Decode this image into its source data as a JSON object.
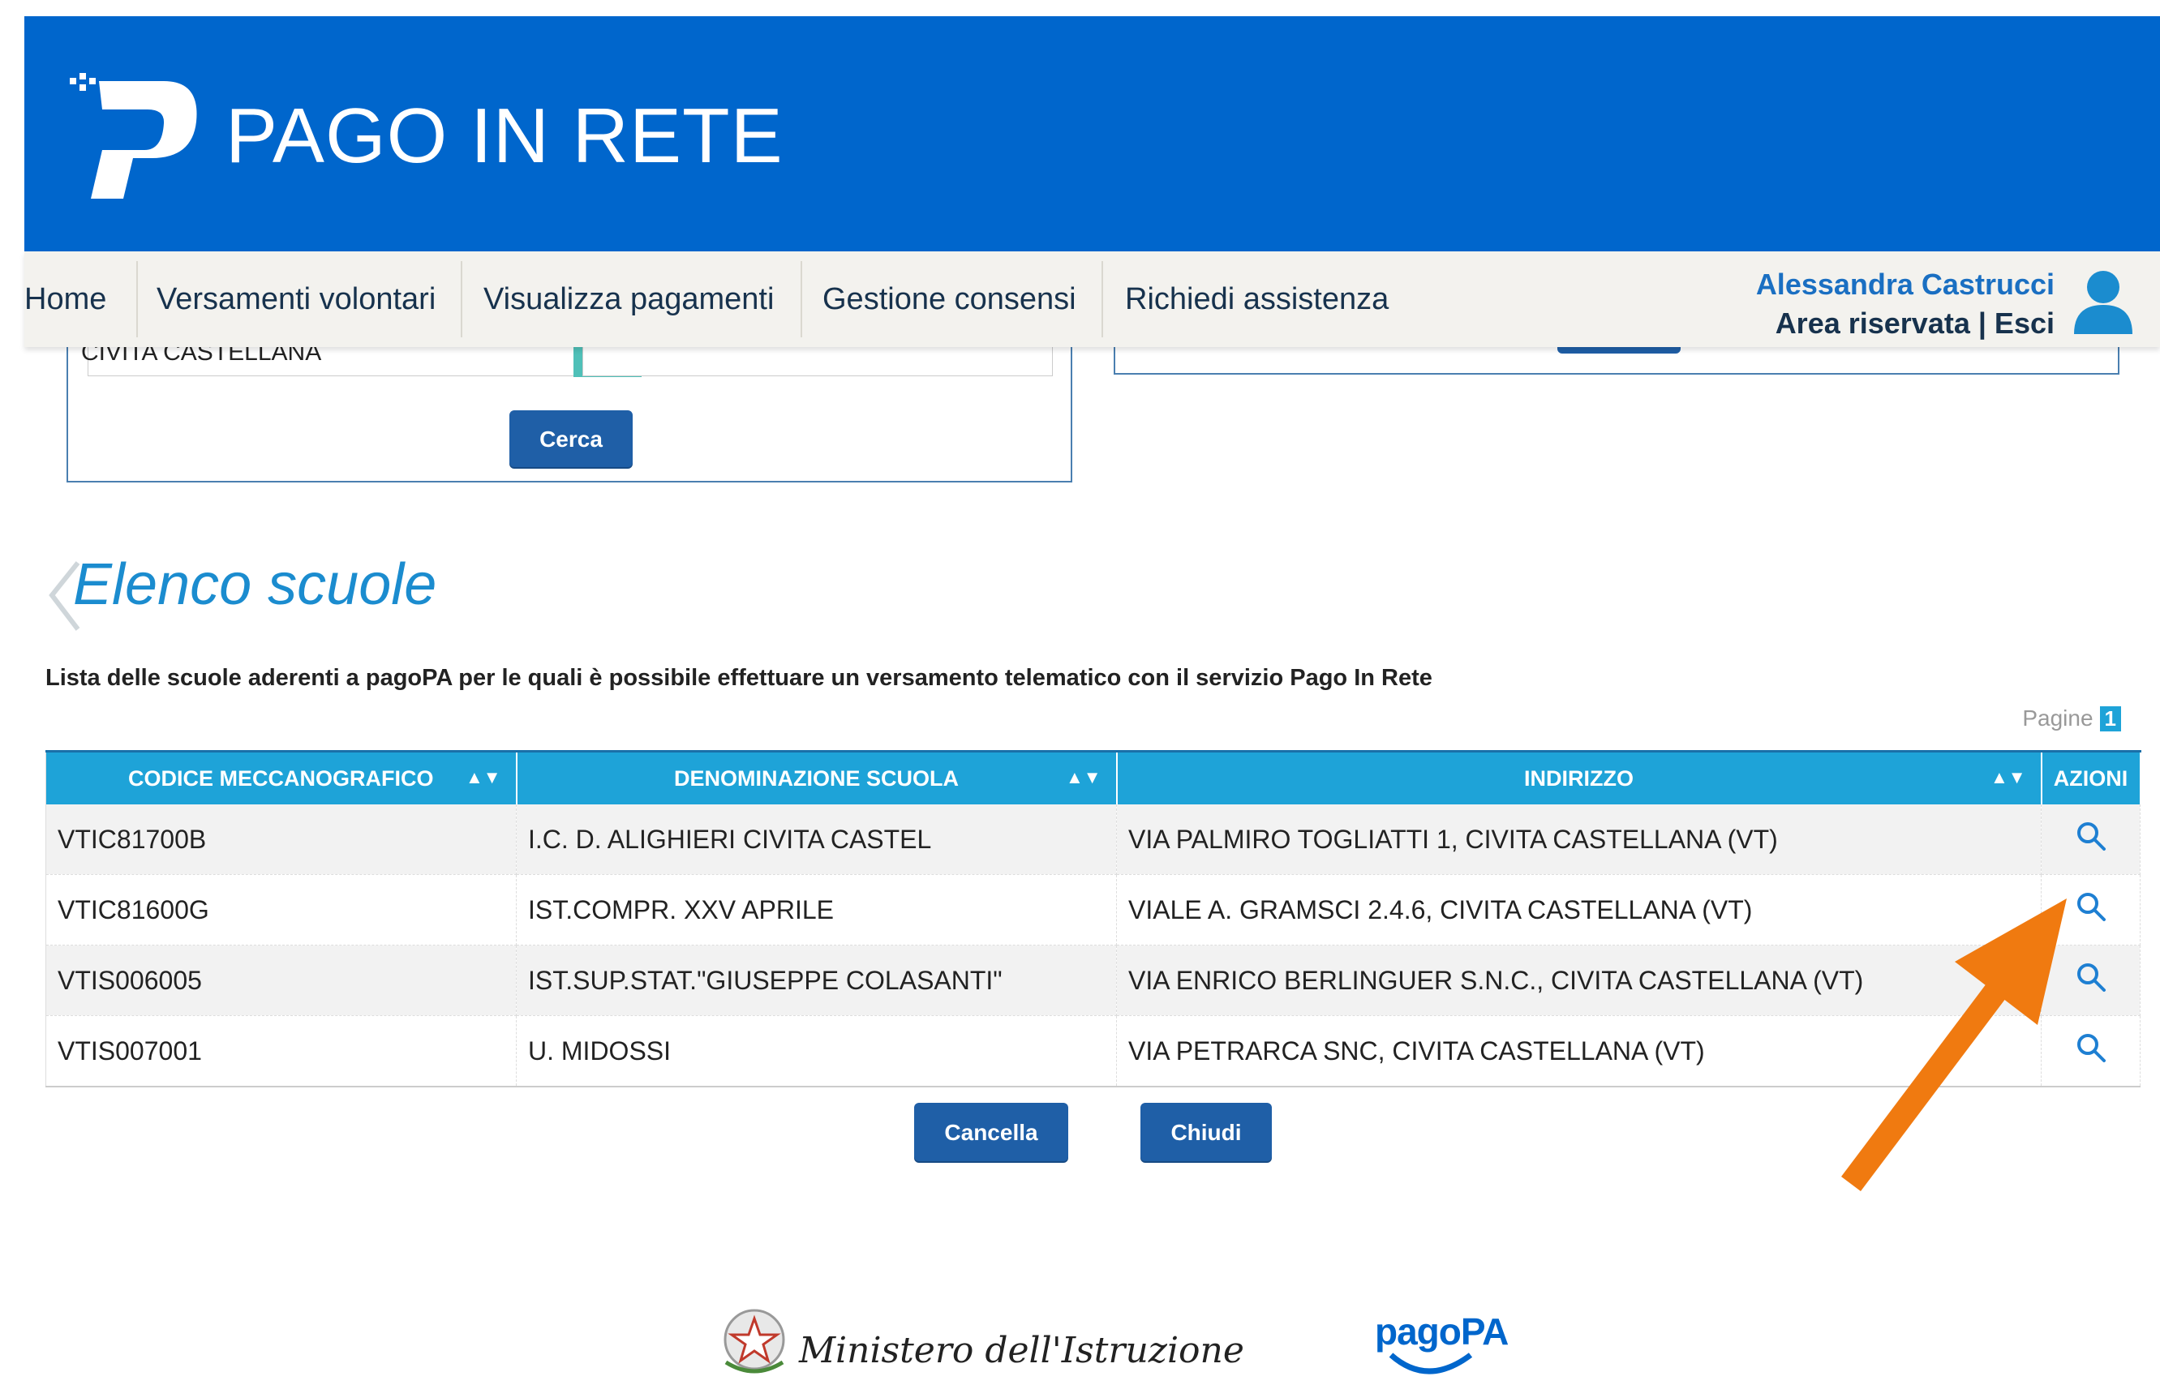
{
  "header": {
    "brand": "PAGO IN RETE",
    "color": "#0066CC"
  },
  "nav": {
    "items": [
      "Home",
      "Versamenti volontari",
      "Visualizza pagamenti",
      "Gestione consensi",
      "Richiedi assistenza"
    ],
    "user_name": "Alessandra Castrucci",
    "user_area": "Area riservata | Esci"
  },
  "search": {
    "selected_comune": "CIVITA CASTELLANA",
    "button_label": "Cerca"
  },
  "section": {
    "title": "Elenco scuole",
    "subtitle": "Lista delle scuole aderenti a pagoPA per le quali è possibile effettuare un versamento telematico con il servizio Pago In Rete",
    "pages_label": "Pagine",
    "current_page": "1"
  },
  "table": {
    "headers": [
      "CODICE MECCANOGRAFICO",
      "DENOMINAZIONE SCUOLA",
      "INDIRIZZO",
      "AZIONI"
    ],
    "rows": [
      {
        "codice": "VTIC81700B",
        "denominazione": "I.C. D. ALIGHIERI CIVITA CASTEL",
        "indirizzo": "VIA PALMIRO TOGLIATTI 1, CIVITA CASTELLANA (VT)",
        "action_icon": "search-icon"
      },
      {
        "codice": "VTIC81600G",
        "denominazione": "IST.COMPR. XXV APRILE",
        "indirizzo": "VIALE A. GRAMSCI 2.4.6, CIVITA CASTELLANA (VT)",
        "action_icon": "search-icon"
      },
      {
        "codice": "VTIS006005",
        "denominazione": "IST.SUP.STAT.\"GIUSEPPE COLASANTI\"",
        "indirizzo": "VIA ENRICO BERLINGUER S.N.C., CIVITA CASTELLANA (VT)",
        "action_icon": "search-icon"
      },
      {
        "codice": "VTIS007001",
        "denominazione": "U. MIDOSSI",
        "indirizzo": "VIA PETRARCA SNC, CIVITA CASTELLANA (VT)",
        "action_icon": "search-icon"
      }
    ]
  },
  "buttons": {
    "cancel": "Cancella",
    "close": "Chiudi"
  },
  "footer": {
    "ministero": "Ministero dell'Istruzione",
    "pagopa": "pagoPA"
  },
  "colors": {
    "header_blue": "#0066CC",
    "table_header": "#1ea3d8",
    "button_blue": "#1f5fa7",
    "annotation_arrow": "#f07a10"
  }
}
